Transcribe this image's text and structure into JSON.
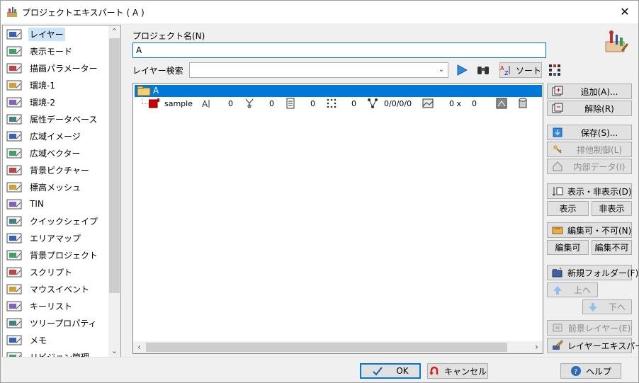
{
  "window": {
    "title": "プロジェクトエキスパート ( A )",
    "close": "✕"
  },
  "sidebar": {
    "items": [
      {
        "label": "レイヤー",
        "icon": "layer-icon",
        "selected": true
      },
      {
        "label": "表示モード",
        "icon": "display-mode-icon"
      },
      {
        "label": "描画パラメーター",
        "icon": "draw-params-icon"
      },
      {
        "label": "環境-1",
        "icon": "environment-1-icon"
      },
      {
        "label": "環境-2",
        "icon": "environment-2-icon"
      },
      {
        "label": "属性データベース",
        "icon": "attribute-db-icon"
      },
      {
        "label": "広域イメージ",
        "icon": "wide-image-icon"
      },
      {
        "label": "広域ベクター",
        "icon": "wide-vector-icon"
      },
      {
        "label": "背景ピクチャー",
        "icon": "background-picture-icon"
      },
      {
        "label": "標高メッシュ",
        "icon": "elevation-mesh-icon"
      },
      {
        "label": "TIN",
        "icon": "tin-icon"
      },
      {
        "label": "クイックシェイプ",
        "icon": "quick-shape-icon"
      },
      {
        "label": "エリアマップ",
        "icon": "area-map-icon"
      },
      {
        "label": "背景プロジェクト",
        "icon": "background-project-icon"
      },
      {
        "label": "スクリプト",
        "icon": "script-icon"
      },
      {
        "label": "マウスイベント",
        "icon": "mouse-event-icon"
      },
      {
        "label": "キーリスト",
        "icon": "key-list-icon"
      },
      {
        "label": "ツリープロパティ",
        "icon": "tree-property-icon"
      },
      {
        "label": "メモ",
        "icon": "memo-icon"
      },
      {
        "label": "リビジョン管理",
        "icon": "revision-icon"
      }
    ]
  },
  "project": {
    "name_label": "プロジェクト名(N)",
    "name_value": "A"
  },
  "search": {
    "label": "レイヤー検索",
    "value": "",
    "sort_label": "ソート"
  },
  "tree": {
    "root_label": "A",
    "row": {
      "name": "sample",
      "v1": "0",
      "v2": "0",
      "v3": "0",
      "v4": "0",
      "v5": "0/0/0/0",
      "v6": "0 x",
      "v7": "0"
    }
  },
  "buttons": {
    "add": "追加(A)...",
    "remove": "解除(R)",
    "save": "保存(S)...",
    "exclusive": "排他制御(L)",
    "internal": "内部データ(I)",
    "show_hide": "表示・非表示(D)",
    "show": "表示",
    "hide": "非表示",
    "edit_toggle": "編集可・不可(N)",
    "editable": "編集可",
    "not_editable": "編集不可",
    "new_folder": "新規フォルダー(F)",
    "up": "上へ",
    "down": "下へ",
    "foreground": "前景レイヤー(E)",
    "layer_expert": "レイヤーエキスパート"
  },
  "footer": {
    "ok": "OK",
    "cancel": "キャンセル",
    "help": "ヘルプ"
  },
  "colors": {
    "accent": "#0078d7",
    "selection": "#cce4f7"
  }
}
